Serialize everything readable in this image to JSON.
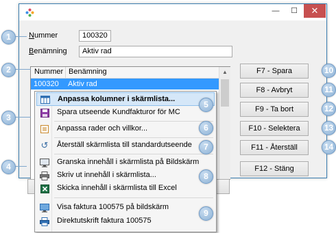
{
  "window": {
    "min_glyph": "—",
    "max_glyph": "☐",
    "close_glyph": "✕"
  },
  "form": {
    "nummer_label": "Nummer",
    "nummer_value": "100320",
    "benamning_label": "Benämning",
    "benamning_value": "Aktiv rad"
  },
  "list": {
    "columns": [
      "Nummer",
      "Benämning"
    ],
    "rows": [
      {
        "nummer": "100320",
        "benamning": "Aktiv rad"
      }
    ]
  },
  "buttons": {
    "save": "F7 - Spara",
    "cancel": "F8 - Avbryt",
    "delete": "F9 - Ta bort",
    "select": "F10 - Selektera",
    "reset": "F11 - Återställ",
    "close": "F12 - Stäng"
  },
  "context_menu": {
    "items": [
      {
        "label": "Anpassa kolumner i skärmlista...",
        "icon": "columns-icon"
      },
      {
        "label": "Spara utseende Kundfakturor för MC",
        "icon": "save-icon"
      },
      {
        "label": "Anpassa rader och villkor...",
        "icon": "list-icon"
      },
      {
        "label": "Återställ skärmlista till standardutseende",
        "icon": "undo-icon"
      },
      {
        "label": "Granska innehåll i skärmlista på Bildskärm",
        "icon": "monitor-icon"
      },
      {
        "label": "Skriv ut innehåll i skärmlista...",
        "icon": "printer-icon"
      },
      {
        "label": "Skicka innehåll i skärmlista till Excel",
        "icon": "excel-icon"
      },
      {
        "label": "Visa faktura 100575 på bildskärm",
        "icon": "monitor-icon"
      },
      {
        "label": "Direktutskrift faktura 100575",
        "icon": "printer-icon"
      }
    ]
  },
  "callouts": [
    "1",
    "2",
    "3",
    "4",
    "5",
    "6",
    "7",
    "8",
    "9",
    "10",
    "11",
    "12",
    "13",
    "14"
  ],
  "colors": {
    "accent": "#3399ff",
    "callout": "#8fb3d6",
    "close": "#c75050"
  }
}
